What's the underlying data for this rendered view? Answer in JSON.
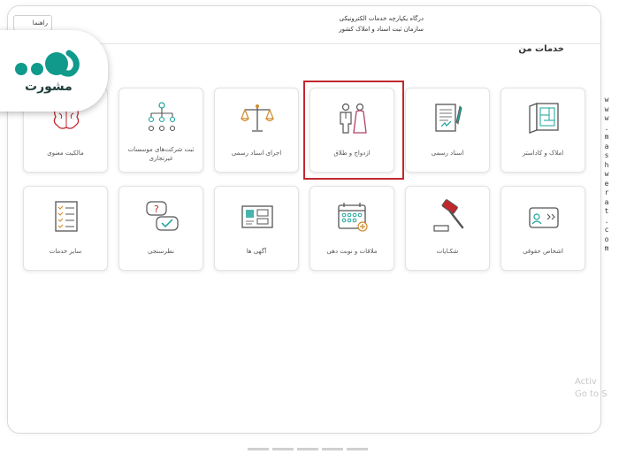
{
  "header": {
    "line1": "درگاه یکپارچه خدمات الکترونیکی",
    "line2": "سازمان ثبت اسناد و املاک کشور",
    "help_label": "راهنما"
  },
  "section_title": "خدمات من",
  "tiles_row1": [
    {
      "label": "املاک و کاداستر",
      "icon": "blueprint-icon"
    },
    {
      "label": "اسناد رسمی",
      "icon": "document-sign-icon"
    },
    {
      "label": "ازدواج و طلاق",
      "icon": "couple-icon"
    },
    {
      "label": "اجرای اسناد رسمی",
      "icon": "scales-icon"
    },
    {
      "label": "ثبت شرکت‌های موسسات غیرتجاری",
      "icon": "org-chart-icon"
    },
    {
      "label": "مالکیت معنوی",
      "icon": "brain-icon"
    }
  ],
  "tiles_row2": [
    {
      "label": "اشخاص حقوقی",
      "icon": "id-card-icon"
    },
    {
      "label": "شکـایات",
      "icon": "gavel-icon"
    },
    {
      "label": "ملاقات و نوبت دهی",
      "icon": "calendar-icon"
    },
    {
      "label": "آگهی ها",
      "icon": "board-icon"
    },
    {
      "label": "نظرسنجی",
      "icon": "survey-bubble-icon"
    },
    {
      "label": "سایر خدمات",
      "icon": "checklist-icon"
    }
  ],
  "logo": {
    "text": "مشورت"
  },
  "watermark": {
    "text": "www.mashwerat.com"
  },
  "activate_text": [
    "Activ",
    "Go to S"
  ],
  "colors": {
    "highlight": "#c0282d",
    "logo_teal": "#0f9a8c",
    "logo_dark": "#1f3e3c",
    "icon_teal": "#19a39a"
  }
}
